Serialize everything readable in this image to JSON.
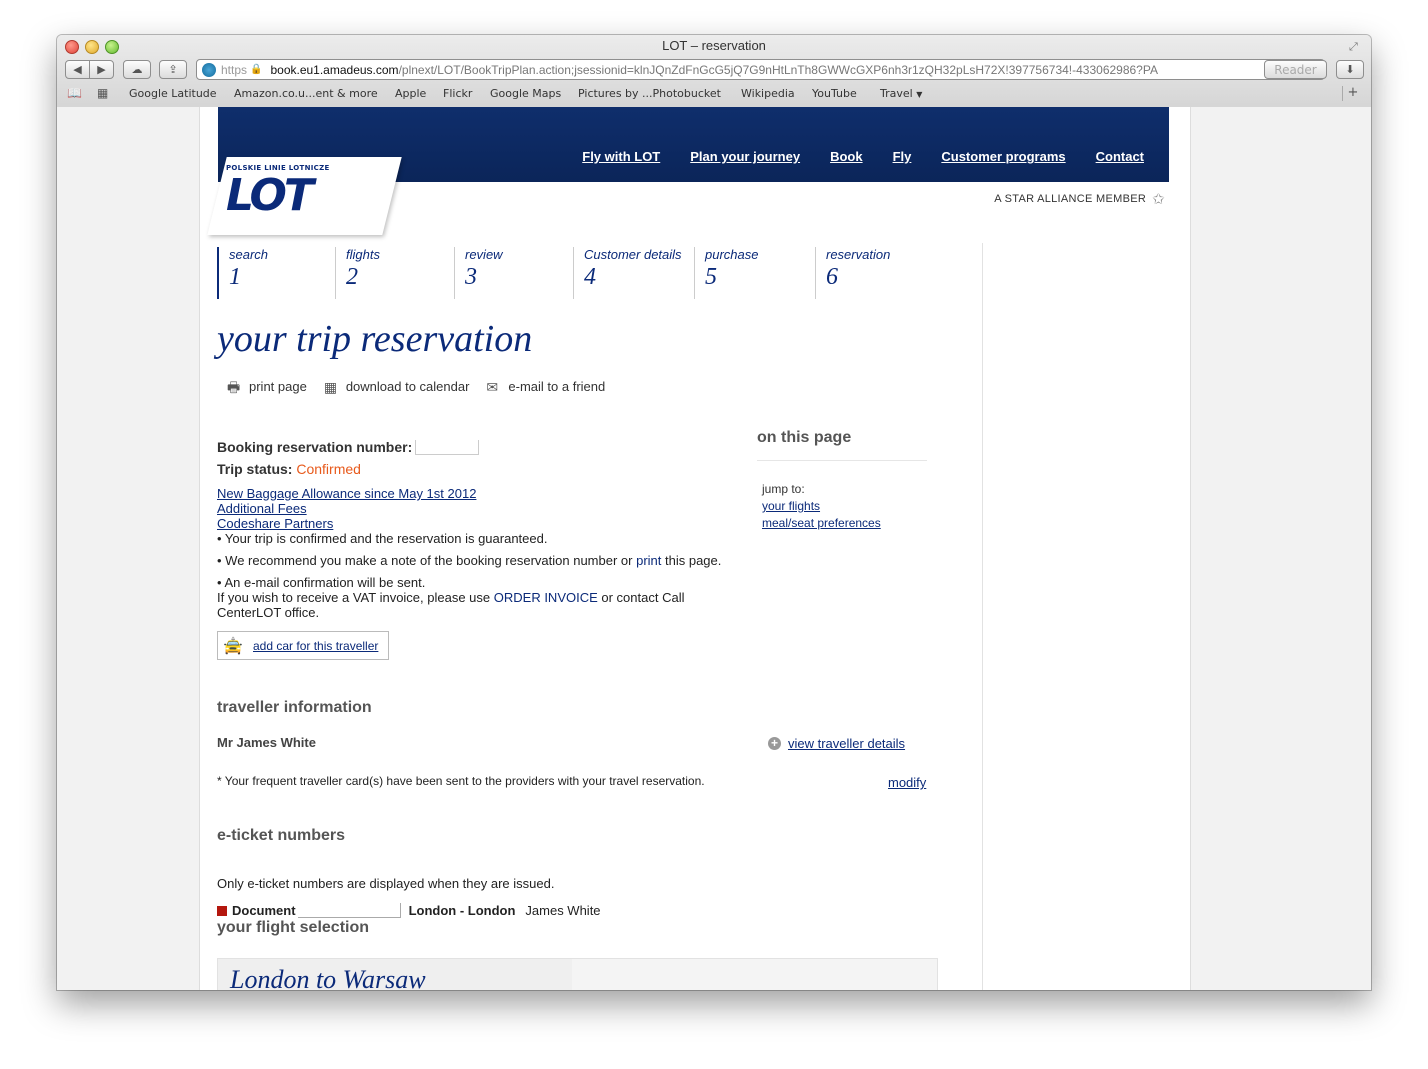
{
  "window": {
    "title": "LOT – reservation",
    "address": {
      "scheme": "https",
      "host": "book.eu1.amadeus.com",
      "path": "/plnext/LOT/BookTripPlan.action;jsessionid=klnJQnZdFnGcG5jQ7G9nHtLnTh8GWWcGXP6nh3r1zQH32pLsH72X!397756734!-433062986?PA"
    },
    "reader_label": "Reader",
    "bookmarks": [
      "Google Latitude",
      "Amazon.co.u...ent & more",
      "Apple",
      "Flickr",
      "Google Maps",
      "Pictures by ...Photobucket",
      "Wikipedia",
      "YouTube",
      "Travel"
    ]
  },
  "header": {
    "logo_small": "POLSKIE LINIE LOTNICZE",
    "logo_big": "LOT",
    "nav": [
      "Fly with LOT",
      "Plan your journey",
      "Book",
      "Fly",
      "Customer programs",
      "Contact"
    ],
    "star_alliance": "A STAR ALLIANCE MEMBER"
  },
  "steps": [
    {
      "label": "search",
      "num": "1"
    },
    {
      "label": "flights",
      "num": "2"
    },
    {
      "label": "review",
      "num": "3"
    },
    {
      "label": "Customer details",
      "num": "4"
    },
    {
      "label": "purchase",
      "num": "5"
    },
    {
      "label": "reservation",
      "num": "6"
    }
  ],
  "main": {
    "title": "your trip reservation",
    "actions": {
      "print": "print page",
      "calendar": "download to calendar",
      "email": "e-mail to a friend"
    },
    "booking_label": "Booking reservation number:",
    "trip_status_label": "Trip status:",
    "trip_status_value": "Confirmed",
    "links": [
      "New Baggage Allowance since May 1st 2012",
      "Additional Fees",
      "Codeshare Partners"
    ],
    "bullet1": "• Your trip is confirmed and the reservation is guaranteed.",
    "bullet2_pre": "• We recommend you make a note of the booking reservation number or ",
    "bullet2_link": "print",
    "bullet2_post": " this page.",
    "bullet3": "• An e-mail confirmation will be sent.",
    "vat_pre": "If you wish to receive a VAT invoice, please use ",
    "vat_link": "ORDER INVOICE ",
    "vat_post": "or contact Call CenterLOT office.",
    "add_car": "add car for this traveller",
    "traveller_heading": "traveller information",
    "traveller_name": "Mr James White",
    "view_details": "view traveller details",
    "ff_note": "* Your frequent traveller card(s) have been sent to the providers with your travel reservation.",
    "modify": "modify",
    "eticket_heading": "e-ticket numbers",
    "eticket_note": "Only e-ticket numbers are displayed when they are issued.",
    "doc_label": "Document",
    "doc_route": "London - London",
    "doc_name": "James White",
    "flight_heading": "your flight selection",
    "flight_title": "London to Warsaw"
  },
  "sidebar": {
    "heading": "on this page",
    "jump_label": "jump to:",
    "links": [
      "your flights",
      "meal/seat preferences"
    ]
  },
  "colors": {
    "brand_navy": "#0b2a79",
    "status_orange": "#e85a1c",
    "doc_marker": "#b4170e"
  }
}
